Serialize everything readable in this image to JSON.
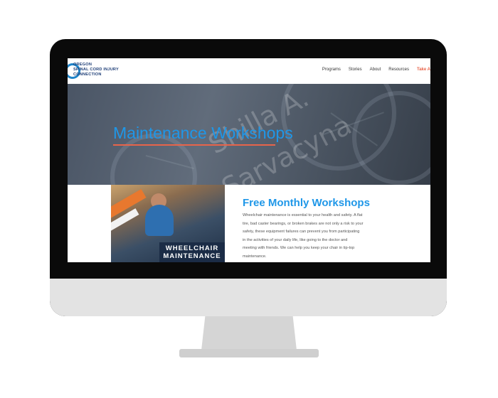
{
  "site": {
    "logo_lines": [
      "OREGON",
      "SPINAL CORD INJURY",
      "CONNECTION"
    ]
  },
  "nav": {
    "items": [
      "Programs",
      "Stories",
      "About",
      "Resources"
    ],
    "cta": "Take A"
  },
  "hero": {
    "title": "Maintenance Workshops",
    "watermark_line1": "Shilla A.",
    "watermark_line2": "Sarvacyna"
  },
  "feature": {
    "image_label_lines": [
      "WHEELCHAIR",
      "MAINTENANCE"
    ],
    "title": "Free Monthly Workshops",
    "body_lines": [
      "Wheelchair maintenance is essential to your health and safety. A flat",
      "tire, bad caster bearings, or broken brakes are not only a risk to your",
      "safety, these equipment failures can prevent you from participating",
      "in the activities of your daily life, like going to the doctor and",
      "meeting with friends. We can help you keep your chair in tip-top",
      "maintenance."
    ]
  },
  "colors": {
    "accent_blue": "#1f97e8",
    "accent_orange": "#e8644a",
    "logo_navy": "#1f3f78"
  }
}
